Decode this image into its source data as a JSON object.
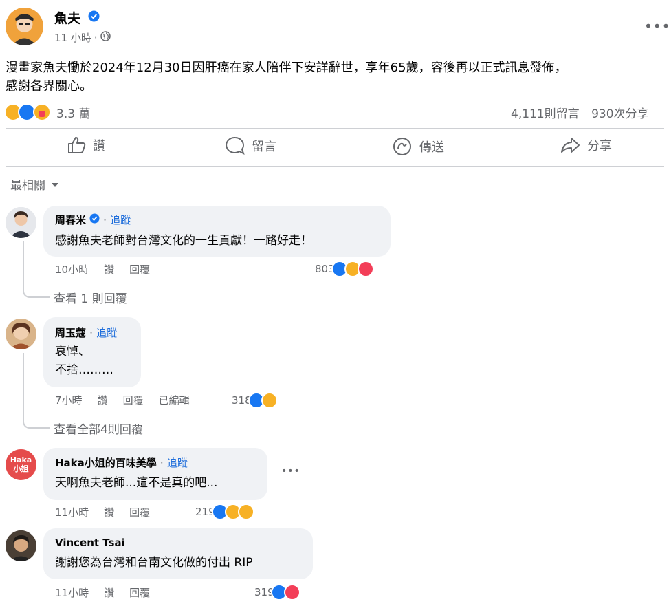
{
  "post": {
    "author": "魚夫",
    "time": "11 小時",
    "text_line1": "漫畫家魚夫慟於2024年12月30日因肝癌在家人陪伴下安詳辭世，享年65歲，容後再以正式訊息發佈，",
    "text_line2": "感謝各界關心。",
    "reaction_count": "3.3 萬",
    "comments_count": "4,111則留言",
    "shares_count": "930次分享"
  },
  "actions": {
    "like": "讚",
    "comment": "留言",
    "send": "傳送",
    "share": "分享"
  },
  "sort_label": "最相關",
  "comments": [
    {
      "name": "周春米",
      "verified": true,
      "follow": "追蹤",
      "text": "感謝魚夫老師對台灣文化的一生貢獻！一路好走！",
      "time": "10小時",
      "like": "讚",
      "reply": "回覆",
      "reactions": "803",
      "view_replies": "查看 1 則回覆"
    },
    {
      "name": "周玉蔻",
      "follow": "追蹤",
      "text_line1": "哀悼、",
      "text_line2": "不捨………",
      "time": "7小時",
      "like": "讚",
      "reply": "回覆",
      "edited": "已編輯",
      "reactions": "318",
      "view_replies": "查看全部4則回覆"
    },
    {
      "name": "Haka小姐的百味美學",
      "follow": "追蹤",
      "text": "天啊魚夫老師...這不是真的吧...",
      "time": "11小時",
      "like": "讚",
      "reply": "回覆",
      "reactions": "219",
      "avatar_text_1": "Haka",
      "avatar_text_2": "小姐"
    },
    {
      "name": "Vincent Tsai",
      "text": "謝謝您為台灣和台南文化做的付出 RIP",
      "time": "11小時",
      "like": "讚",
      "reply": "回覆",
      "reactions": "319"
    }
  ],
  "colors": {
    "link_blue": "#216fdb",
    "like_blue": "#1877f2",
    "love_red": "#f33e58",
    "sad_yellow": "#f7b125",
    "muted": "#65676b",
    "bubble": "#f0f2f5"
  }
}
